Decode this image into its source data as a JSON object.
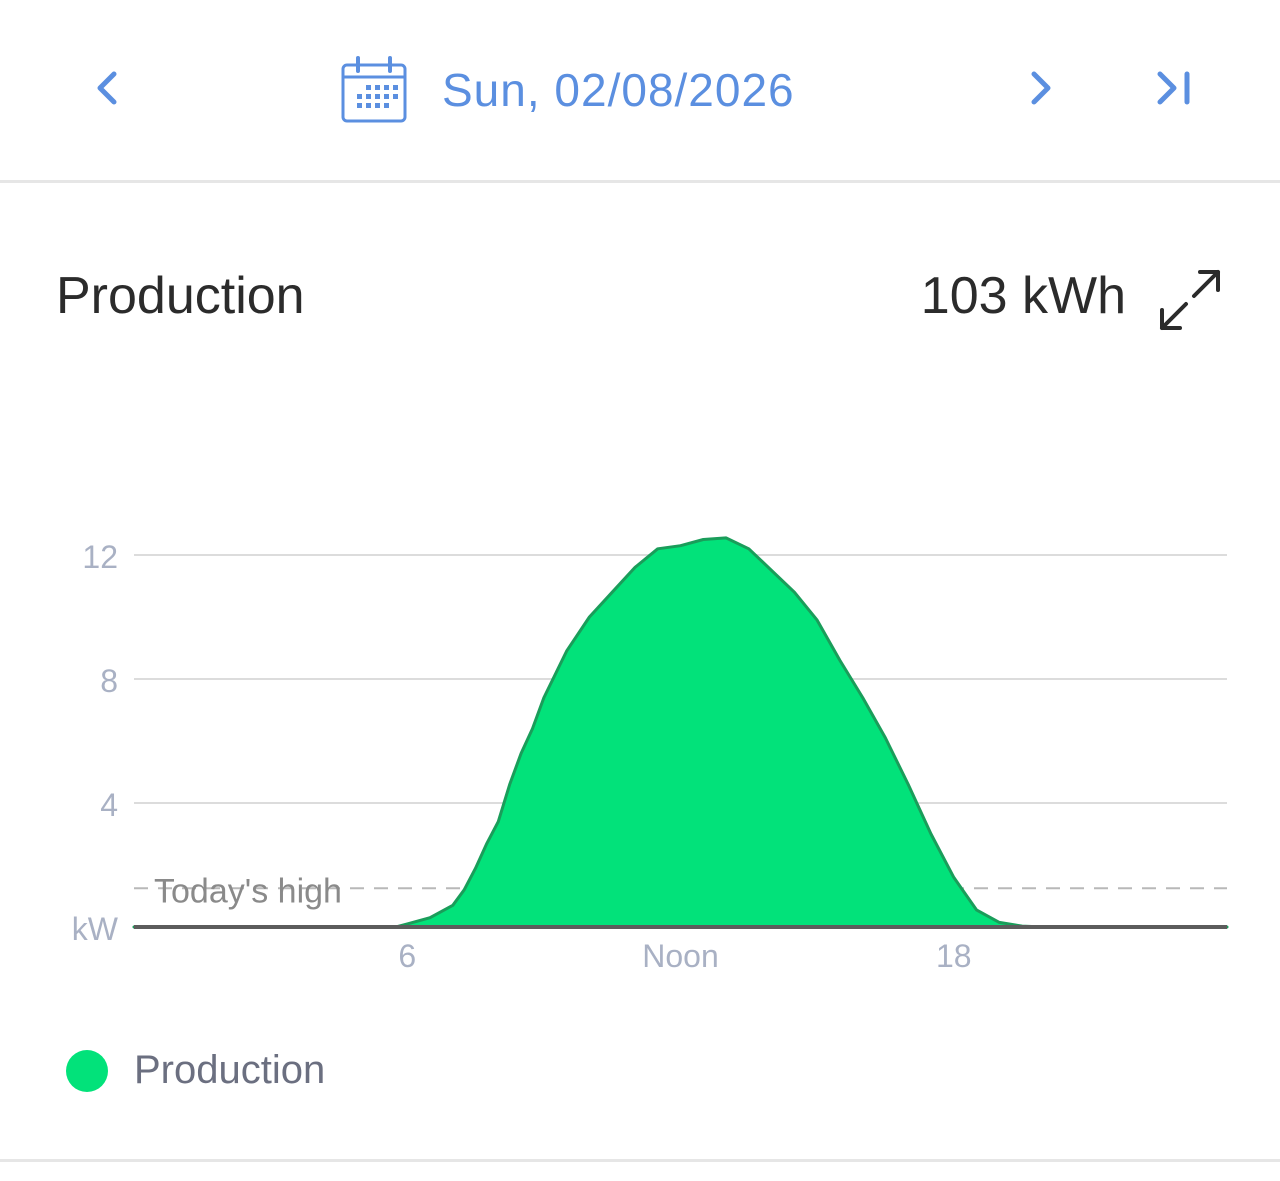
{
  "header": {
    "date": "Sun, 02/08/2026",
    "icons": {
      "previous": "chevron-left-icon",
      "calendar": "calendar-icon",
      "next": "chevron-right-icon",
      "last": "skip-to-end-icon"
    }
  },
  "card": {
    "title": "Production",
    "total": "103 kWh",
    "expand_icon": "expand-icon"
  },
  "legend": {
    "label": "Production",
    "color": "#02e27a"
  },
  "colors": {
    "accent": "#5b8fe0",
    "fill": "#02e27a",
    "stroke": "#1a9d5a",
    "grid": "#dcdcdc",
    "axis": "#5c5c5c",
    "tick_label": "#a9b1c4"
  },
  "chart_data": {
    "type": "area",
    "ylabel": "kW",
    "xlim": [
      0,
      24
    ],
    "ylim": [
      0,
      13
    ],
    "y_ticks": [
      {
        "value": 4,
        "label": "4"
      },
      {
        "value": 8,
        "label": "8"
      },
      {
        "value": 12,
        "label": "12"
      }
    ],
    "x_ticks": [
      {
        "value": 6,
        "label": "6"
      },
      {
        "value": 12,
        "label": "Noon"
      },
      {
        "value": 18,
        "label": "18"
      }
    ],
    "grid": true,
    "reference_line": {
      "label": "Today's high",
      "value": 1.25
    },
    "series": [
      {
        "name": "Production",
        "x": [
          0,
          5.75,
          6,
          6.5,
          7,
          7.25,
          7.5,
          7.75,
          8,
          8.25,
          8.5,
          8.75,
          9,
          9.5,
          10,
          10.5,
          11,
          11.5,
          12,
          12.5,
          13,
          13.5,
          14,
          14.5,
          15,
          15.5,
          16,
          16.5,
          17,
          17.5,
          18,
          18.5,
          19,
          19.5,
          20,
          20.5,
          21,
          22,
          24
        ],
        "y": [
          0,
          0,
          0.1,
          0.3,
          0.7,
          1.2,
          1.9,
          2.7,
          3.4,
          4.6,
          5.6,
          6.4,
          7.4,
          8.9,
          10.0,
          10.8,
          11.6,
          12.2,
          12.3,
          12.5,
          12.55,
          12.2,
          11.5,
          10.8,
          9.9,
          8.6,
          7.4,
          6.1,
          4.6,
          3.0,
          1.6,
          0.55,
          0.15,
          0.03,
          0,
          0,
          0,
          0,
          0
        ]
      }
    ]
  }
}
